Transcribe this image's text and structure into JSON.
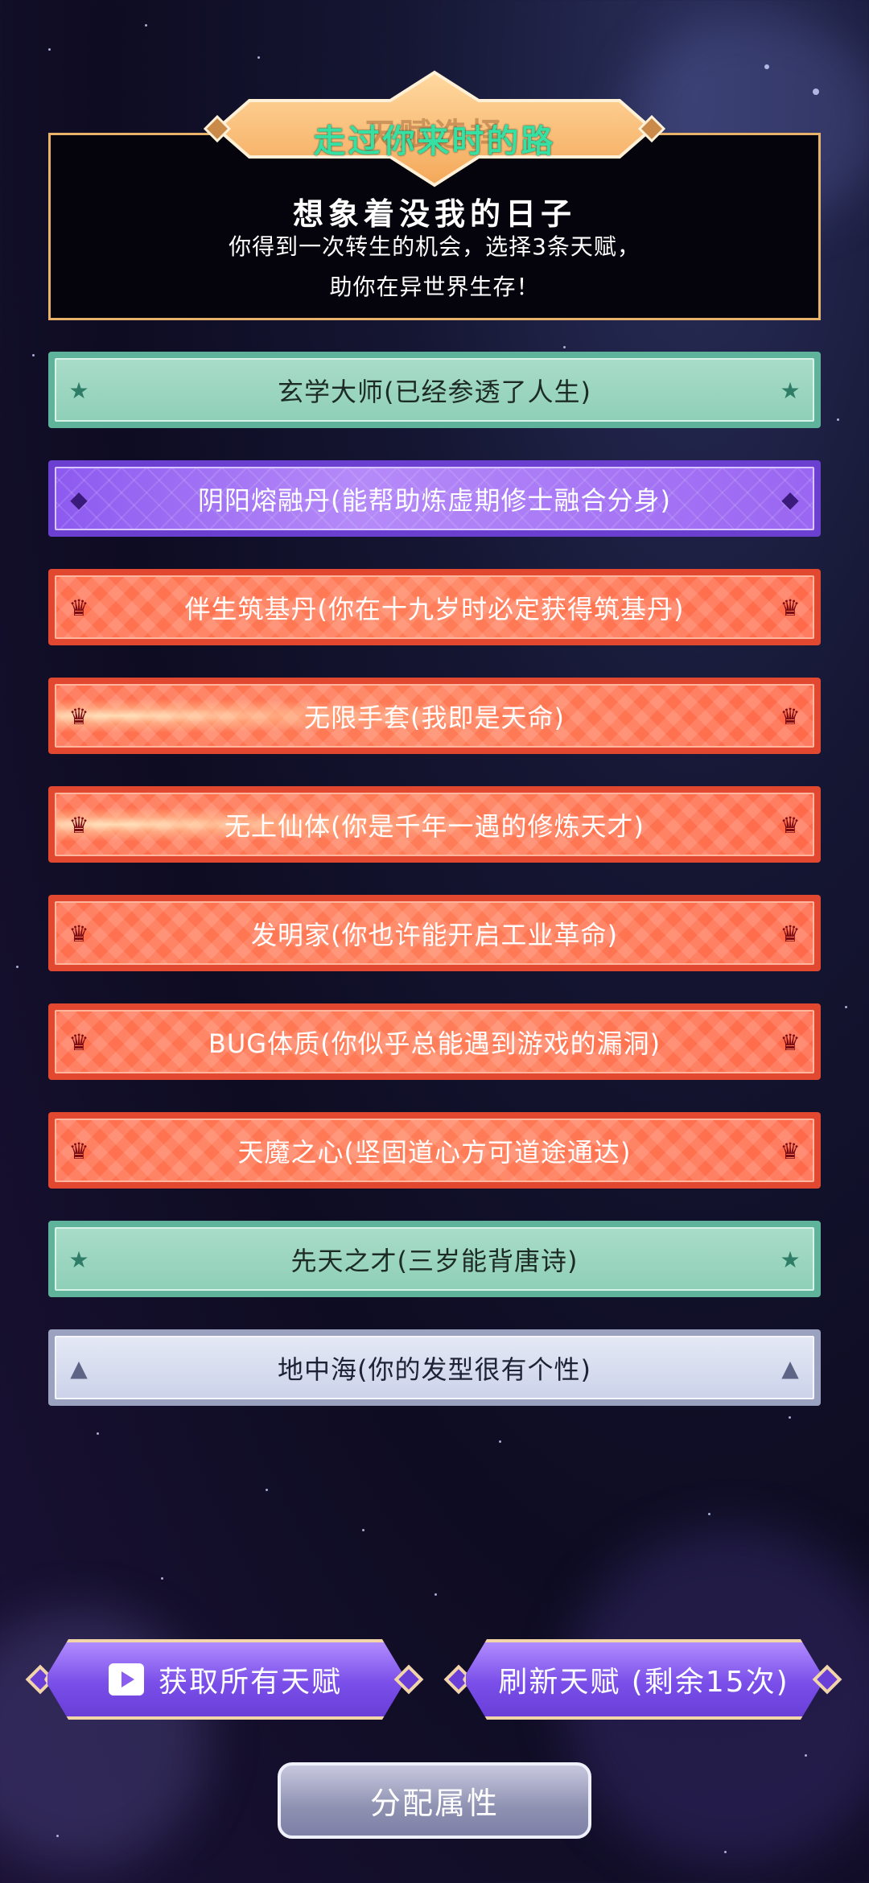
{
  "header": {
    "banner_title": "走过你来时的路",
    "banner_ghost_title": "天赋选择",
    "subtitle": "想象着没我的日子",
    "desc_line1": "你得到一次转生的机会，选择3条天赋，",
    "desc_line2": "助你在异世界生存！"
  },
  "talents": [
    {
      "label": "玄学大师(已经参透了人生)",
      "tier": "green",
      "icon": "star-icon"
    },
    {
      "label": "阴阳熔融丹(能帮助炼虚期修士融合分身)",
      "tier": "purple",
      "icon": "gem-icon"
    },
    {
      "label": "伴生筑基丹(你在十九岁时必定获得筑基丹)",
      "tier": "red",
      "icon": "crown-icon"
    },
    {
      "label": "无限手套(我即是天命)",
      "tier": "red",
      "icon": "crown-icon"
    },
    {
      "label": "无上仙体(你是千年一遇的修炼天才)",
      "tier": "red",
      "icon": "crown-icon"
    },
    {
      "label": "发明家(你也许能开启工业革命)",
      "tier": "red",
      "icon": "crown-icon"
    },
    {
      "label": "BUG体质(你似乎总能遇到游戏的漏洞)",
      "tier": "red",
      "icon": "crown-icon"
    },
    {
      "label": "天魔之心(坚固道心方可道途通达)",
      "tier": "red",
      "icon": "crown-icon"
    },
    {
      "label": "先天之才(三岁能背唐诗)",
      "tier": "green",
      "icon": "star-icon"
    },
    {
      "label": "地中海(你的发型很有个性)",
      "tier": "gray",
      "icon": "triangle-icon"
    }
  ],
  "buttons": {
    "get_all": "获取所有天赋",
    "refresh": "刷新天赋 (剩余15次)",
    "allocate": "分配属性"
  },
  "colors": {
    "green": "#a8dcc8",
    "purple": "#8d5af0",
    "red": "#ff6f4e",
    "gray": "#d6dbee",
    "banner_text": "#35e0a2",
    "frame": "#e8b26a"
  }
}
